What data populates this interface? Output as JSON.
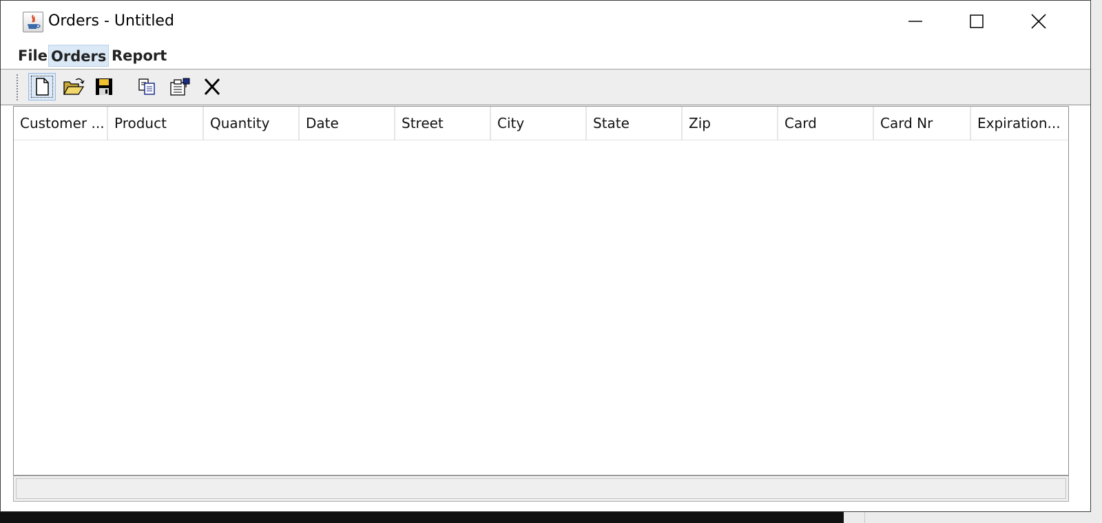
{
  "window": {
    "title": "Orders - Untitled"
  },
  "menu": [
    "File",
    "Orders",
    "Report"
  ],
  "toolbar": [
    "new-document-icon",
    "open-folder-icon",
    "save-disk-icon",
    "copy-icon",
    "properties-icon",
    "delete-icon"
  ],
  "table": {
    "columns": [
      "Customer ...",
      "Product",
      "Quantity",
      "Date",
      "Street",
      "City",
      "State",
      "Zip",
      "Card",
      "Card Nr",
      "Expiration..."
    ],
    "rows": []
  },
  "statusbar": {
    "text": ""
  }
}
